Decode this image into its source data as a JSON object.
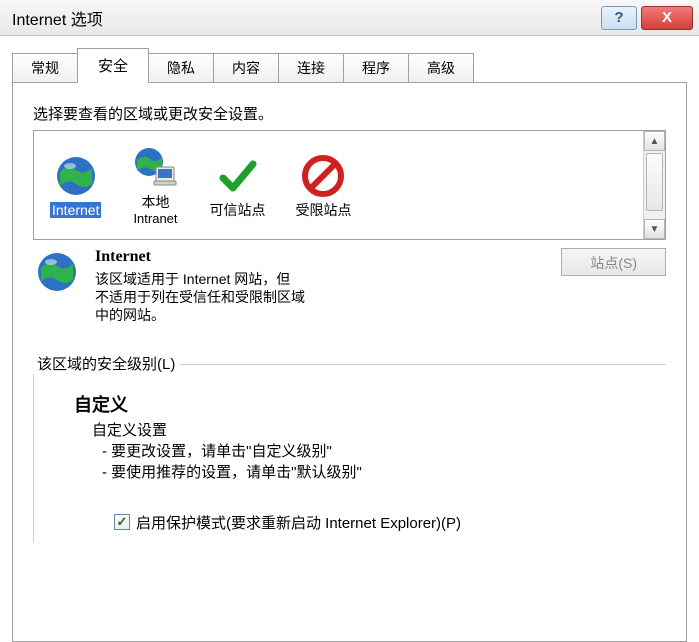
{
  "window": {
    "title": "Internet 选项",
    "help_label": "?",
    "close_label": "X"
  },
  "tabs": [
    {
      "label": "常规"
    },
    {
      "label": "安全"
    },
    {
      "label": "隐私"
    },
    {
      "label": "内容"
    },
    {
      "label": "连接"
    },
    {
      "label": "程序"
    },
    {
      "label": "高级"
    }
  ],
  "active_tab": 1,
  "security": {
    "select_label": "选择要查看的区域或更改安全设置。",
    "zones": [
      {
        "label": "Internet",
        "sub": ""
      },
      {
        "label": "本地",
        "sub": "Intranet"
      },
      {
        "label": "可信站点",
        "sub": ""
      },
      {
        "label": "受限站点",
        "sub": ""
      }
    ],
    "detail": {
      "name": "Internet",
      "desc_l1": "该区域适用于 Internet 网站，但",
      "desc_l2": "不适用于列在受信任和受限制区域",
      "desc_l3": "中的网站。"
    },
    "sites_button": "站点(S)",
    "level_label": "该区域的安全级别(L)",
    "custom": {
      "hd": "自定义",
      "sub": "自定义设置",
      "li1": "- 要更改设置，请单击\"自定义级别\"",
      "li2": "- 要使用推荐的设置，请单击\"默认级别\""
    },
    "protected_mode": "启用保护模式(要求重新启动 Internet Explorer)(P)"
  }
}
